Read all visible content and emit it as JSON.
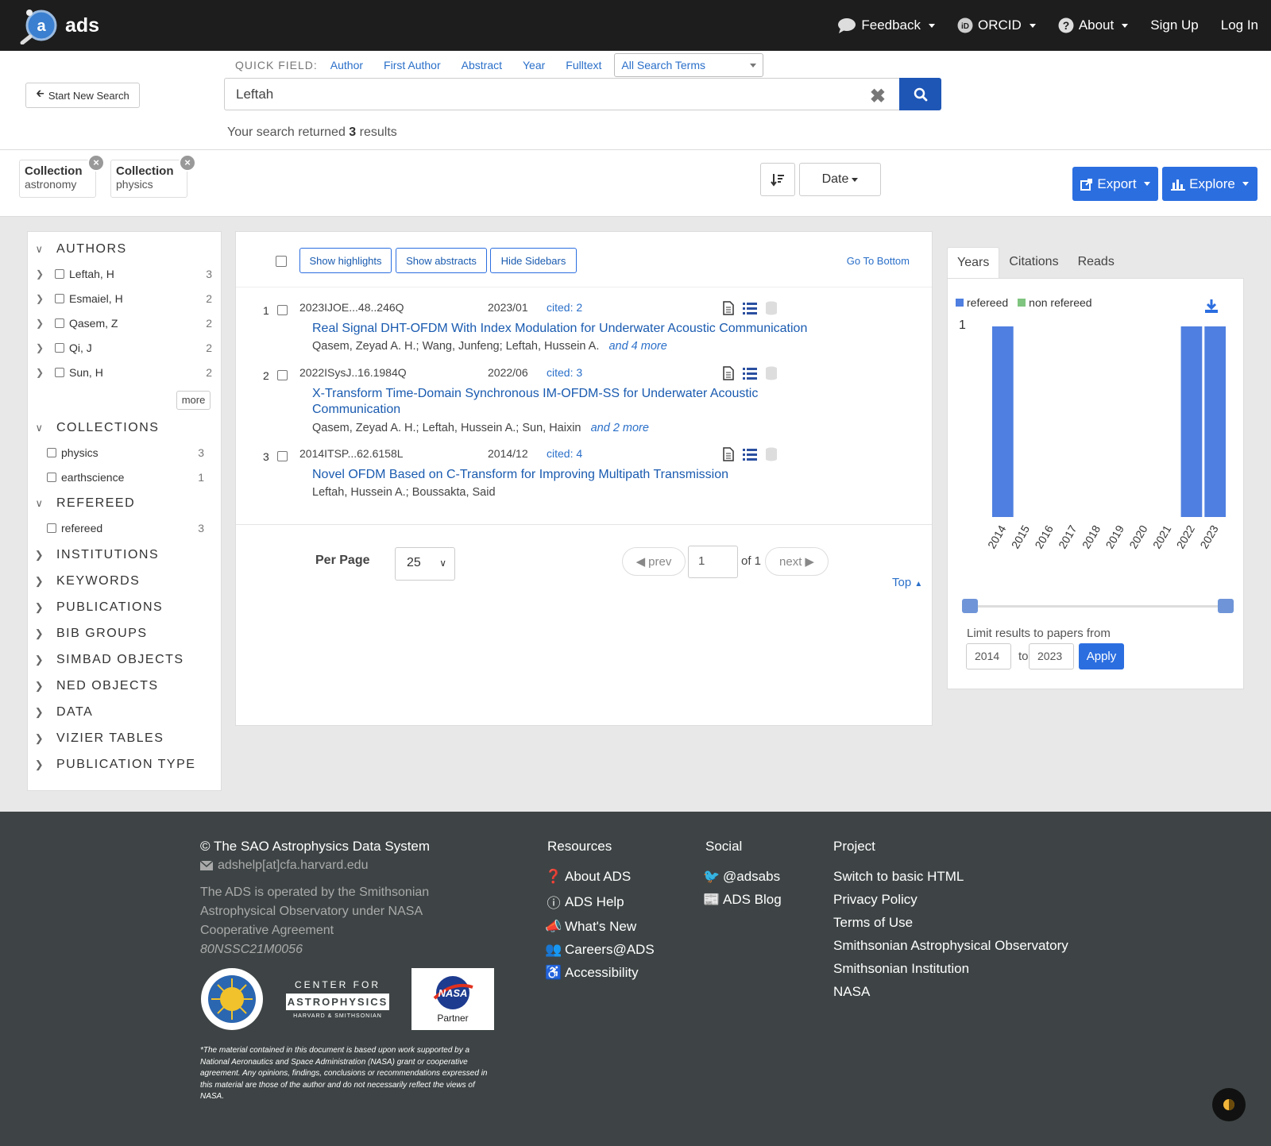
{
  "nav": {
    "brand": "ads",
    "items": [
      {
        "label": "Feedback",
        "icon": "comment-icon",
        "dropdown": true
      },
      {
        "label": "ORCID",
        "icon": "orcid-icon",
        "dropdown": true
      },
      {
        "label": "About",
        "icon": "question-circle-icon",
        "dropdown": true
      },
      {
        "label": "Sign Up",
        "dropdown": false
      },
      {
        "label": "Log In",
        "dropdown": false
      }
    ]
  },
  "search": {
    "new_search_label": "Start New Search",
    "quick_field_label": "QUICK FIELD:",
    "quick_fields": [
      "Author",
      "First Author",
      "Abstract",
      "Year",
      "Fulltext"
    ],
    "field_select": "All Search Terms",
    "query": "Leftah",
    "results_prefix": "Your search returned",
    "results_count": "3",
    "results_suffix": "results"
  },
  "filters": [
    {
      "category": "Collection",
      "value": "astronomy"
    },
    {
      "category": "Collection",
      "value": "physics"
    }
  ],
  "sort": {
    "label": "Date"
  },
  "actions": {
    "export": "Export",
    "explore": "Explore"
  },
  "facets": {
    "authors": {
      "title": "AUTHORS",
      "items": [
        {
          "label": "Leftah, H",
          "count": "3"
        },
        {
          "label": "Esmaiel, H",
          "count": "2"
        },
        {
          "label": "Qasem, Z",
          "count": "2"
        },
        {
          "label": "Qi, J",
          "count": "2"
        },
        {
          "label": "Sun, H",
          "count": "2"
        }
      ],
      "more": "more"
    },
    "collections": {
      "title": "COLLECTIONS",
      "items": [
        {
          "label": "physics",
          "count": "3"
        },
        {
          "label": "earthscience",
          "count": "1"
        }
      ]
    },
    "refereed": {
      "title": "REFEREED",
      "items": [
        {
          "label": "refereed",
          "count": "3"
        }
      ]
    },
    "collapsed": [
      "INSTITUTIONS",
      "KEYWORDS",
      "PUBLICATIONS",
      "BIB GROUPS",
      "SIMBAD OBJECTS",
      "NED OBJECTS",
      "DATA",
      "VIZIER TABLES",
      "PUBLICATION TYPE"
    ]
  },
  "results": {
    "toolbar": {
      "show_highlights": "Show highlights",
      "show_abstracts": "Show abstracts",
      "hide_sidebars": "Hide Sidebars",
      "go_to_bottom": "Go To Bottom"
    },
    "items": [
      {
        "num": "1",
        "bibcode": "2023IJOE...48..246Q",
        "date": "2023/01",
        "cited": "cited: 2",
        "title": "Real Signal DHT-OFDM With Index Modulation for Underwater Acoustic Communication",
        "authors": "Qasem, Zeyad A. H.;  Wang, Junfeng;  Leftah, Hussein A.",
        "more": "and 4 more"
      },
      {
        "num": "2",
        "bibcode": "2022ISysJ..16.1984Q",
        "date": "2022/06",
        "cited": "cited: 3",
        "title": "X-Transform Time-Domain Synchronous IM-OFDM-SS for Underwater Acoustic Communication",
        "authors": "Qasem, Zeyad A. H.;  Leftah, Hussein A.;  Sun, Haixin",
        "more": "and 2 more"
      },
      {
        "num": "3",
        "bibcode": "2014ITSP...62.6158L",
        "date": "2014/12",
        "cited": "cited: 4",
        "title": "Novel OFDM Based on C-Transform for Improving Multipath Transmission",
        "authors": "Leftah, Hussein A.;  Boussakta, Said",
        "more": ""
      }
    ],
    "pagination": {
      "per_page_label": "Per Page",
      "per_page": "25",
      "prev": "prev",
      "page": "1",
      "of": "of 1",
      "next": "next",
      "top": "Top"
    }
  },
  "graph": {
    "tabs": [
      "Years",
      "Citations",
      "Reads"
    ],
    "legend": [
      {
        "label": "refereed",
        "color": "#4f7fe0"
      },
      {
        "label": "non refereed",
        "color": "#7fc47f"
      }
    ],
    "limit_label": "Limit results to papers from",
    "from": "2014",
    "to_label": "to",
    "to": "2023",
    "apply": "Apply"
  },
  "chart_data": {
    "type": "bar",
    "categories": [
      "2014",
      "2015",
      "2016",
      "2017",
      "2018",
      "2019",
      "2020",
      "2021",
      "2022",
      "2023"
    ],
    "series": [
      {
        "name": "refereed",
        "values": [
          1,
          0,
          0,
          0,
          0,
          0,
          0,
          0,
          1,
          1
        ]
      },
      {
        "name": "non refereed",
        "values": [
          0,
          0,
          0,
          0,
          0,
          0,
          0,
          0,
          0,
          0
        ]
      }
    ],
    "y_ticks": [
      "1"
    ],
    "ylim": [
      0,
      1
    ],
    "colors": {
      "refereed": "#4f7fe0",
      "non refereed": "#7fc47f"
    },
    "legend_position": "top-left",
    "grid": false
  },
  "footer": {
    "copyright": "© The SAO Astrophysics Data System",
    "email": "adshelp[at]cfa.harvard.edu",
    "operated": "The ADS is operated by the Smithsonian Astrophysical Observatory under NASA Cooperative Agreement",
    "agreement": "80NSSC21M0056",
    "logos": {
      "cfa_line1": "CENTER FOR",
      "cfa_line2": "ASTROPHYSICS",
      "cfa_line3": "HARVARD & SMITHSONIAN",
      "nasa_partner": "Partner"
    },
    "disclaimer": "*The material contained in this document is based upon work supported by a National Aeronautics and Space Administration (NASA) grant or cooperative agreement. Any opinions, findings, conclusions or recommendations expressed in this material are those of the author and do not necessarily reflect the views of NASA.",
    "resources": {
      "title": "Resources",
      "links": [
        {
          "label": "About ADS",
          "icon": "question-circle-icon"
        },
        {
          "label": "ADS Help",
          "icon": "info-circle-icon"
        },
        {
          "label": "What's New",
          "icon": "bullhorn-icon"
        },
        {
          "label": "Careers@ADS",
          "icon": "users-icon"
        },
        {
          "label": "Accessibility",
          "icon": "accessibility-icon"
        }
      ]
    },
    "social": {
      "title": "Social",
      "links": [
        {
          "label": "@adsabs",
          "icon": "twitter-icon"
        },
        {
          "label": "ADS Blog",
          "icon": "newspaper-icon"
        }
      ]
    },
    "project": {
      "title": "Project",
      "links": [
        "Switch to basic HTML",
        "Privacy Policy",
        "Terms of Use",
        "Smithsonian Astrophysical Observatory",
        "Smithsonian Institution",
        "NASA"
      ]
    }
  }
}
